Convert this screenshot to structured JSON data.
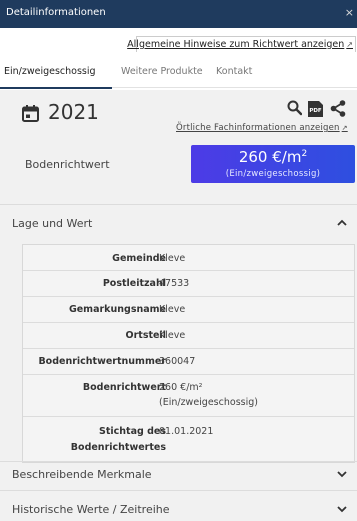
{
  "window": {
    "title": "Detailinformationen",
    "close": "×"
  },
  "hint_link": "Allgemeine Hinweise zum Richtwert anzeigen",
  "tabs": [
    {
      "label": "Ein/zweigeschossig",
      "active": true
    },
    {
      "label": "Weitere Produkte",
      "active": false
    },
    {
      "label": "Kontakt",
      "active": false
    }
  ],
  "year": "2021",
  "fach_link": "Örtliche Fachinformationen anzeigen",
  "bodenrichtwert": {
    "label": "Bodenrichtwert",
    "value": "260 €/m",
    "exponent": "2",
    "sub": "(Ein/zweigeschossig)"
  },
  "section_lage": {
    "title": "Lage und Wert",
    "expanded": true
  },
  "details": [
    {
      "label": "Gemeinde",
      "value": "Kleve"
    },
    {
      "label": "Postleitzahl",
      "value": "47533"
    },
    {
      "label": "Gemarkungsname",
      "value": "Kleve"
    },
    {
      "label": "Ortsteil",
      "value": "Kleve"
    },
    {
      "label": "Bodenrichtwertnummer",
      "value": "360047"
    },
    {
      "label": "Bodenrichtwert",
      "value_line1": "260 €/m²",
      "value_line2": "(Ein/zweigeschossig)"
    },
    {
      "label_line1": "Stichtag des",
      "label_line2": "Bodenrichtwertes",
      "value": "01.01.2021"
    }
  ],
  "section_merkmale": {
    "title": "Beschreibende Merkmale",
    "expanded": false
  },
  "section_historie": {
    "title": "Historische Werte / Zeitreihe",
    "expanded": false
  },
  "icons": [
    "calendar-icon",
    "search-icon",
    "pdf-icon",
    "share-icon",
    "external-link-icon",
    "chevron-up-icon",
    "chevron-down-icon"
  ],
  "colors": {
    "titlebar": "#1f3b5e",
    "value_box_start": "#4d3be6",
    "value_box_end": "#2e4fe0"
  }
}
